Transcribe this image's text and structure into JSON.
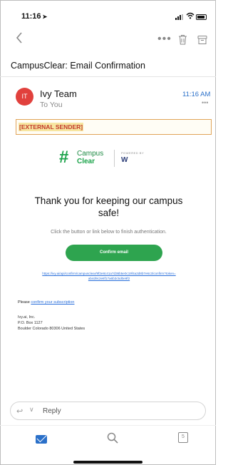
{
  "status_bar": {
    "time": "11:16",
    "location_arrow": "➤"
  },
  "toolbar": {
    "back_icon": "chevron-left-icon",
    "more_label": "•••"
  },
  "email": {
    "subject": "CampusClear: Email Confirmation",
    "sender_initials": "IT",
    "sender_name": "Ivy Team",
    "recipient": "To You",
    "time": "11:16 AM",
    "meta_dots": "•••",
    "external_banner": "[EXTERNAL SENDER]"
  },
  "logo": {
    "symbol": "#",
    "brand_line1": "Campus",
    "brand_line2": "Clear",
    "powered_by": "POWERED BY",
    "partner": "W"
  },
  "body": {
    "headline": "Thank you for keeping our campus safe!",
    "instruction": "Click the button or link below to finish authentication.",
    "confirm_button": "Confirm email",
    "auth_link": "https://ivy.ai/api/confirm/campusclear/9f2e8c41a7d36b5e0c19f4a2d8b7e6c3/confirm?token=ab4d9c2e8f17a6b3c5d0e9f2",
    "please_prefix": "Please",
    "please_link": "confirm your subscription"
  },
  "address": {
    "line1": "Ivy.ai, Inc.",
    "line2": "P.O. Box 1127",
    "line3": "Boulder Colorado 80306 United States"
  },
  "reply": {
    "arrow": "↩",
    "chevron": "∨",
    "label": "Reply"
  },
  "tabs": {
    "calendar_day": "5"
  },
  "colors": {
    "accent_blue": "#2a70c9",
    "brand_green": "#2ea44f",
    "avatar_red": "#e1413d",
    "warning_red": "#c23a2a"
  }
}
